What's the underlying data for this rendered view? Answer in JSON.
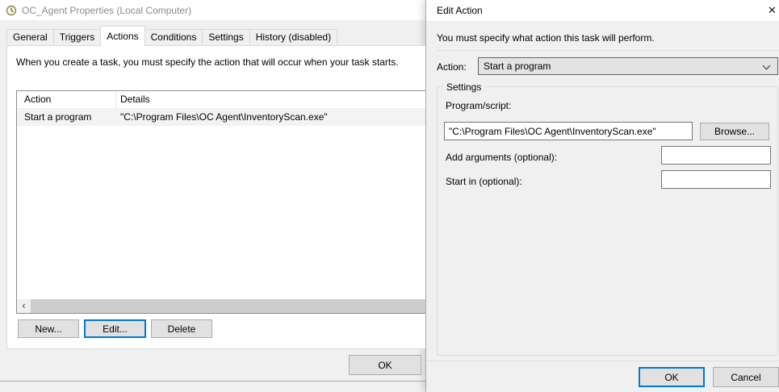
{
  "left_window": {
    "title": "OC_Agent Properties (Local Computer)",
    "tabs": [
      {
        "label": "General"
      },
      {
        "label": "Triggers"
      },
      {
        "label": "Actions"
      },
      {
        "label": "Conditions"
      },
      {
        "label": "Settings"
      },
      {
        "label": "History (disabled)"
      }
    ],
    "active_tab": "Actions",
    "instruction": "When you create a task, you must specify the action that will occur when your task starts.",
    "list": {
      "columns": {
        "action": "Action",
        "details": "Details"
      },
      "row": {
        "action": "Start a program",
        "details": "\"C:\\Program Files\\OC Agent\\InventoryScan.exe\""
      }
    },
    "buttons": {
      "new": "New...",
      "edit": "Edit...",
      "delete": "Delete",
      "ok": "OK"
    },
    "icons": {
      "scroll_left": "‹"
    }
  },
  "edit_dialog": {
    "title": "Edit Action",
    "description": "You must specify what action this task will perform.",
    "action_label": "Action:",
    "action_value": "Start a program",
    "settings": {
      "group_label": "Settings",
      "program_label": "Program/script:",
      "program_value": "\"C:\\Program Files\\OC Agent\\InventoryScan.exe\"",
      "arguments_label": "Add arguments (optional):",
      "arguments_value": "",
      "startin_label": "Start in (optional):",
      "startin_value": "",
      "browse": "Browse..."
    },
    "buttons": {
      "ok": "OK",
      "cancel": "Cancel"
    },
    "icons": {
      "close": "✕"
    }
  },
  "colors": {
    "accent": "#0078d7",
    "selected_row": "#f3f3f3"
  }
}
